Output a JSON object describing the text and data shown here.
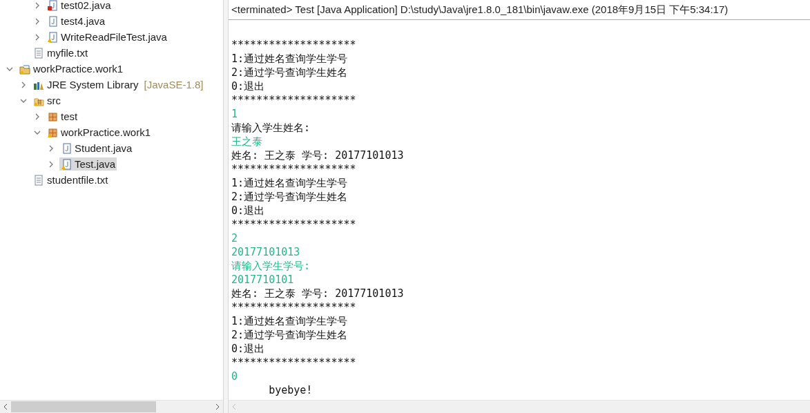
{
  "tree": [
    {
      "children": [
        {
          "children": [
            {
              "label": "test02.java",
              "kind": "java_error",
              "expanded": false,
              "selected": false
            },
            {
              "label": "test4.java",
              "kind": "java",
              "expanded": false,
              "selected": false
            },
            {
              "label": "WriteReadFileTest.java",
              "kind": "java_warning",
              "expanded": false,
              "selected": false
            }
          ]
        },
        {
          "label": "myfile.txt",
          "kind": "text",
          "selected": false
        }
      ]
    },
    {
      "label": "workPractice.work1",
      "kind": "project",
      "expanded": true,
      "selected": false,
      "children": [
        {
          "label": "JRE System Library",
          "decoration": "[JavaSE-1.8]",
          "kind": "library",
          "expanded": false,
          "selected": false
        },
        {
          "label": "src",
          "kind": "source",
          "expanded": true,
          "selected": false,
          "children": [
            {
              "label": "test",
              "kind": "package",
              "expanded": false,
              "selected": false
            },
            {
              "label": "workPractice.work1",
              "kind": "package_warning",
              "expanded": true,
              "selected": false,
              "children": [
                {
                  "label": "Student.java",
                  "kind": "java",
                  "expanded": false,
                  "selected": false
                },
                {
                  "label": "Test.java",
                  "kind": "java_warning",
                  "expanded": false,
                  "selected": true
                }
              ]
            }
          ]
        },
        {
          "label": "studentfile.txt",
          "kind": "text",
          "selected": false
        }
      ]
    }
  ],
  "console": {
    "header": "<terminated> Test [Java Application] D:\\study\\Java\\jre1.8.0_181\\bin\\javaw.exe (2018年9月15日 下午5:34:17)",
    "lines": [
      {
        "text": "********************",
        "kind": "output"
      },
      {
        "text": "1:通过姓名查询学生学号",
        "kind": "output"
      },
      {
        "text": "2:通过学号查询学生姓名",
        "kind": "output"
      },
      {
        "text": "0:退出",
        "kind": "output"
      },
      {
        "text": "********************",
        "kind": "output"
      },
      {
        "text": "1",
        "kind": "input"
      },
      {
        "text": "请输入学生姓名:",
        "kind": "output"
      },
      {
        "text": "王之泰",
        "kind": "input"
      },
      {
        "text": "姓名: 王之泰 学号: 20177101013",
        "kind": "output"
      },
      {
        "text": "********************",
        "kind": "output"
      },
      {
        "text": "1:通过姓名查询学生学号",
        "kind": "output"
      },
      {
        "text": "2:通过学号查询学生姓名",
        "kind": "output"
      },
      {
        "text": "0:退出",
        "kind": "output"
      },
      {
        "text": "********************",
        "kind": "output"
      },
      {
        "text": "2",
        "kind": "input"
      },
      {
        "text": "20177101013",
        "kind": "input"
      },
      {
        "text": "请输入学生学号:",
        "kind": "input"
      },
      {
        "text": "2017710101",
        "kind": "input"
      },
      {
        "text": "姓名: 王之泰 学号: 20177101013",
        "kind": "output"
      },
      {
        "text": "********************",
        "kind": "output"
      },
      {
        "text": "1:通过姓名查询学生学号",
        "kind": "output"
      },
      {
        "text": "2:通过学号查询学生姓名",
        "kind": "output"
      },
      {
        "text": "0:退出",
        "kind": "output"
      },
      {
        "text": "********************",
        "kind": "output"
      },
      {
        "text": "0",
        "kind": "input"
      },
      {
        "text": "\tbyebye!",
        "kind": "output"
      }
    ]
  }
}
